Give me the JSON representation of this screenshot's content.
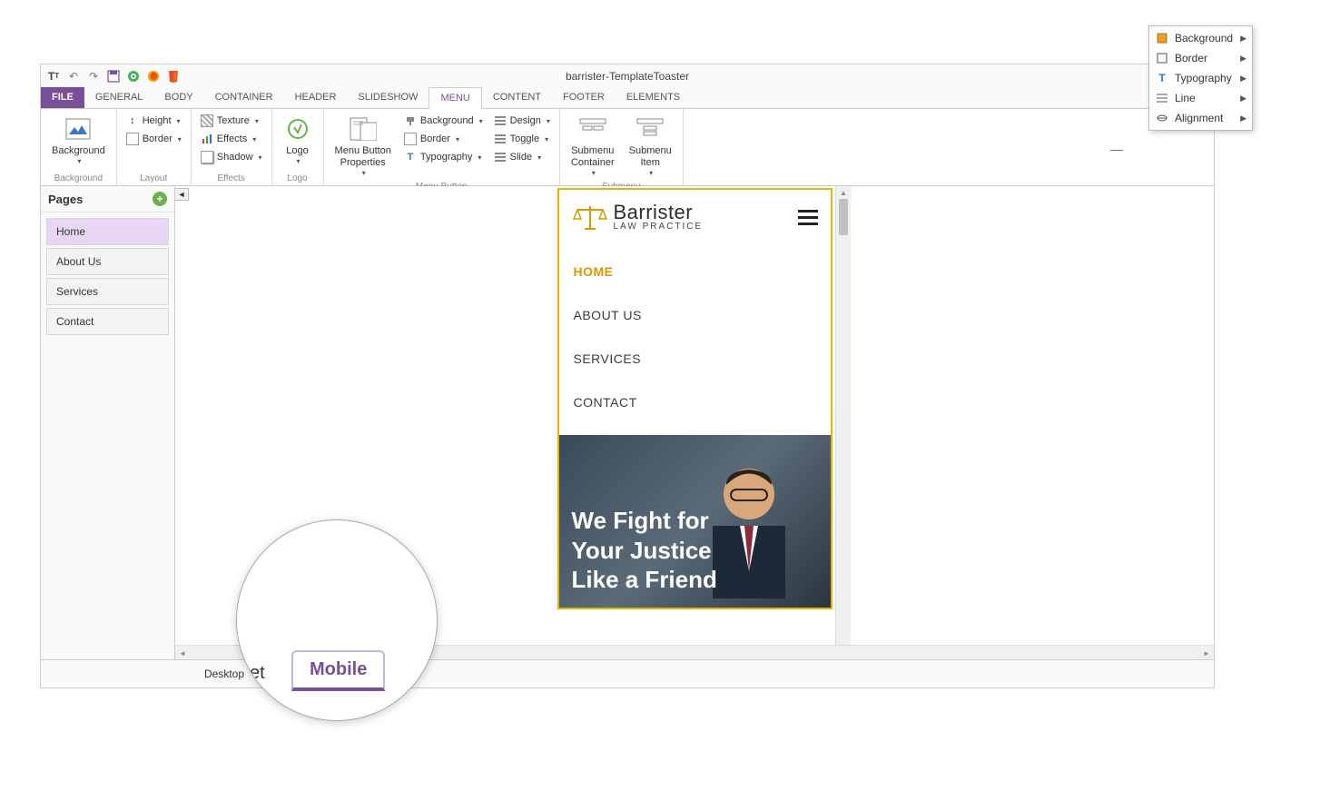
{
  "app": {
    "title": "barrister-TemplateToaster"
  },
  "ribbon": {
    "tabs": {
      "file": "FILE",
      "general": "GENERAL",
      "body": "BODY",
      "container": "CONTAINER",
      "header": "HEADER",
      "slideshow": "SLIDESHOW",
      "menu": "MENU",
      "content": "CONTENT",
      "footer": "FOOTER",
      "elements": "ELEMENTS"
    },
    "groups": {
      "background": {
        "button": "Background",
        "label": "Background"
      },
      "layout": {
        "height": "Height",
        "border": "Border",
        "label": "Layout"
      },
      "effects": {
        "texture": "Texture",
        "effects": "Effects",
        "shadow": "Shadow",
        "label": "Effects"
      },
      "logo": {
        "button": "Logo",
        "label": "Logo"
      },
      "menubutton": {
        "props": "Menu Button\nProperties",
        "background": "Background",
        "border": "Border",
        "typography": "Typography",
        "design": "Design",
        "toggle": "Toggle",
        "slide": "Slide",
        "label": "Menu Button"
      },
      "submenu": {
        "container": "Submenu\nContainer",
        "item": "Submenu\nItem",
        "label": "Submenu"
      }
    }
  },
  "sidebar": {
    "title": "Pages",
    "pages": [
      "Home",
      "About Us",
      "Services",
      "Contact"
    ]
  },
  "preview": {
    "brand_name": "Barrister",
    "brand_sub": "LAW PRACTICE",
    "menu_items": [
      "HOME",
      "ABOUT US",
      "SERVICES",
      "CONTACT"
    ],
    "hero_text": "We Fight for Your Justice Like a Friend"
  },
  "status": {
    "desktop": "Desktop",
    "mobile_big": "Mobile",
    "et_fragment": "et"
  },
  "context_menu": {
    "items": [
      "Background",
      "Border",
      "Typography",
      "Line",
      "Alignment"
    ]
  }
}
